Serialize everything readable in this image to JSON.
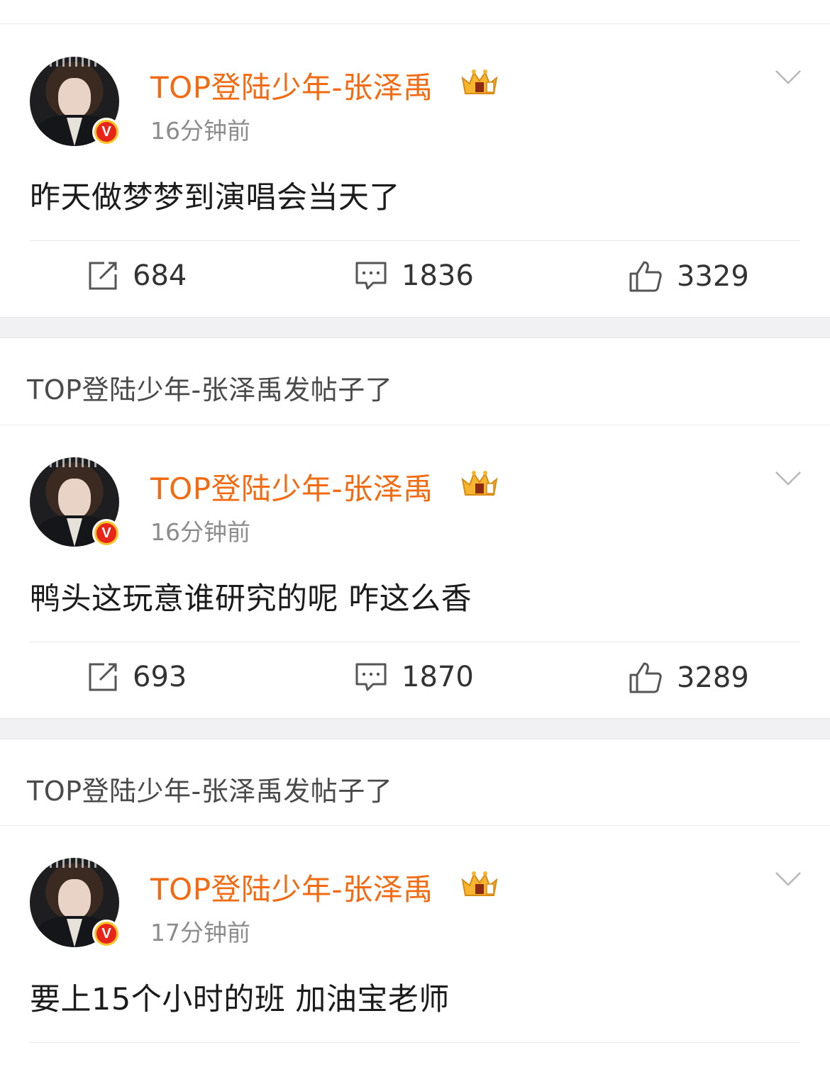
{
  "posts": [
    {
      "author": "TOP登陆少年-张泽禹",
      "time": "16分钟前",
      "text": "昨天做梦梦到演唱会当天了",
      "repost_count": "684",
      "comment_count": "1836",
      "like_count": "3329",
      "verified_badge": "V"
    },
    {
      "header": "TOP登陆少年-张泽禹发帖子了",
      "author": "TOP登陆少年-张泽禹",
      "time": "16分钟前",
      "text": "鸭头这玩意谁研究的呢 咋这么香",
      "repost_count": "693",
      "comment_count": "1870",
      "like_count": "3289",
      "verified_badge": "V"
    },
    {
      "header": "TOP登陆少年-张泽禹发帖子了",
      "author": "TOP登陆少年-张泽禹",
      "time": "17分钟前",
      "text": "要上15个小时的班 加油宝老师",
      "verified_badge": "V"
    }
  ],
  "colors": {
    "username": "#f26b13",
    "timestamp": "#8c8c8c",
    "body_text": "#1b1b1b",
    "gap_background": "#f1f1f3"
  },
  "icons": [
    "repost-icon",
    "comment-icon",
    "like-icon",
    "chevron-down-icon",
    "crown-icon",
    "verified-icon"
  ]
}
